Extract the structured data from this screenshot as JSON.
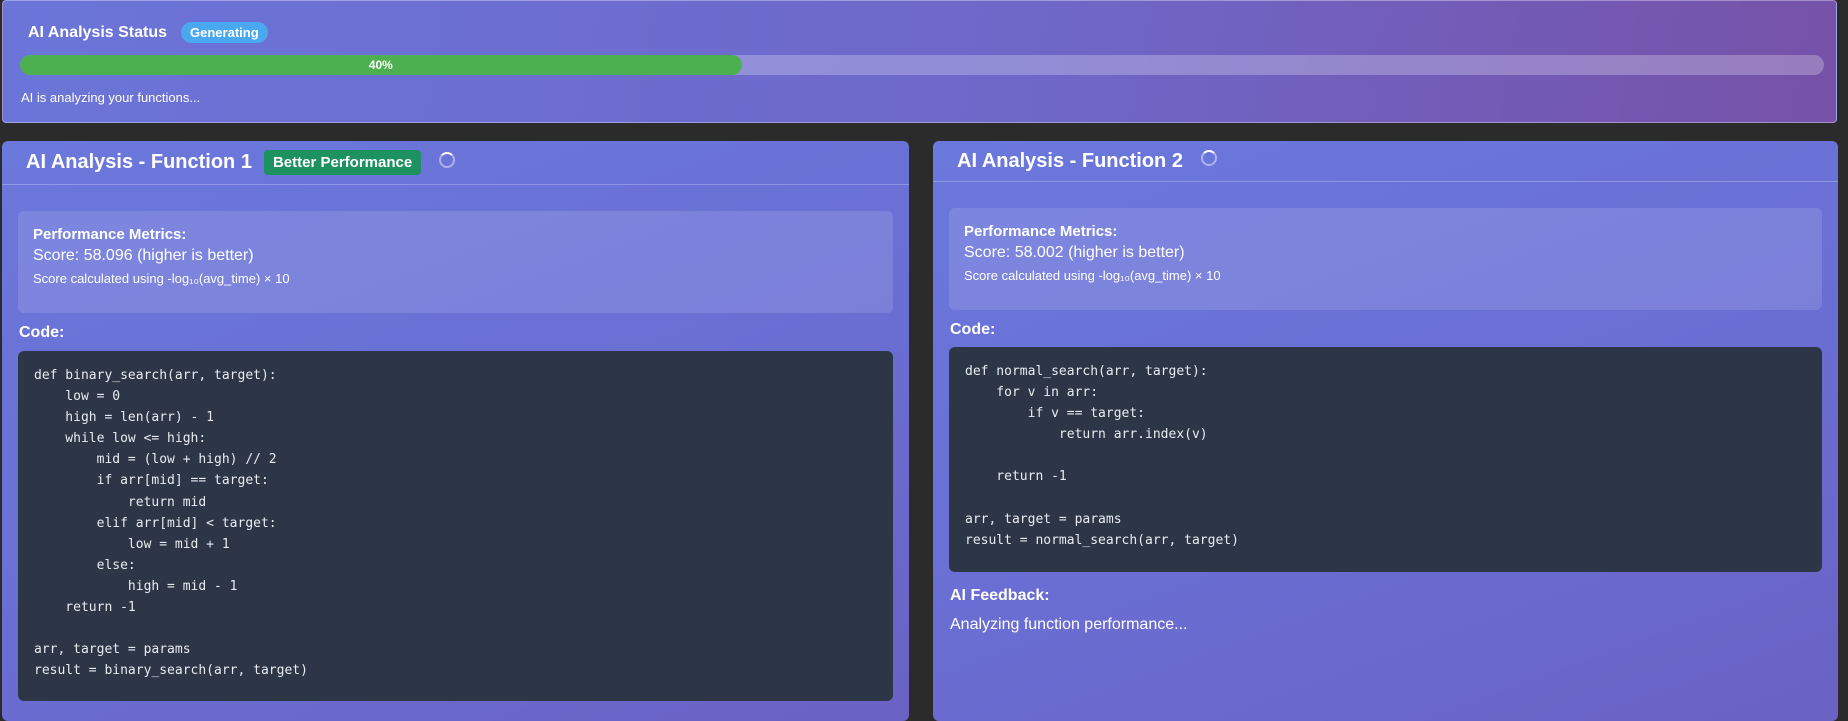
{
  "status": {
    "title": "AI Analysis Status",
    "badge": "Generating",
    "progress_value": 40,
    "progress_label": "40%",
    "message": "AI is analyzing your functions..."
  },
  "function1": {
    "title": "AI Analysis - Function 1",
    "badge": "Better Performance",
    "metrics_title": "Performance Metrics:",
    "score": "Score: 58.096 (higher is better)",
    "score_note": "Score calculated using -log₁₀(avg_time) × 10",
    "code_label": "Code:",
    "code": "def binary_search(arr, target):\n    low = 0\n    high = len(arr) - 1\n    while low <= high:\n        mid = (low + high) // 2\n        if arr[mid] == target:\n            return mid\n        elif arr[mid] < target:\n            low = mid + 1\n        else:\n            high = mid - 1\n    return -1\n\narr, target = params\nresult = binary_search(arr, target)"
  },
  "function2": {
    "title": "AI Analysis - Function 2",
    "metrics_title": "Performance Metrics:",
    "score": "Score: 58.002 (higher is better)",
    "score_note": "Score calculated using -log₁₀(avg_time) × 10",
    "code_label": "Code:",
    "code": "def normal_search(arr, target):\n    for v in arr:\n        if v == target:\n            return arr.index(v)\n\n    return -1\n\narr, target = params\nresult = normal_search(arr, target)",
    "feedback_label": "AI Feedback:",
    "feedback_text": "Analyzing function performance..."
  },
  "colors": {
    "progress_fill": "#4caf50",
    "badge_generating": "#4aa8f0",
    "badge_better": "#1d9160",
    "code_background": "#2d3646"
  },
  "icons": [
    "loading-spinner-icon"
  ]
}
